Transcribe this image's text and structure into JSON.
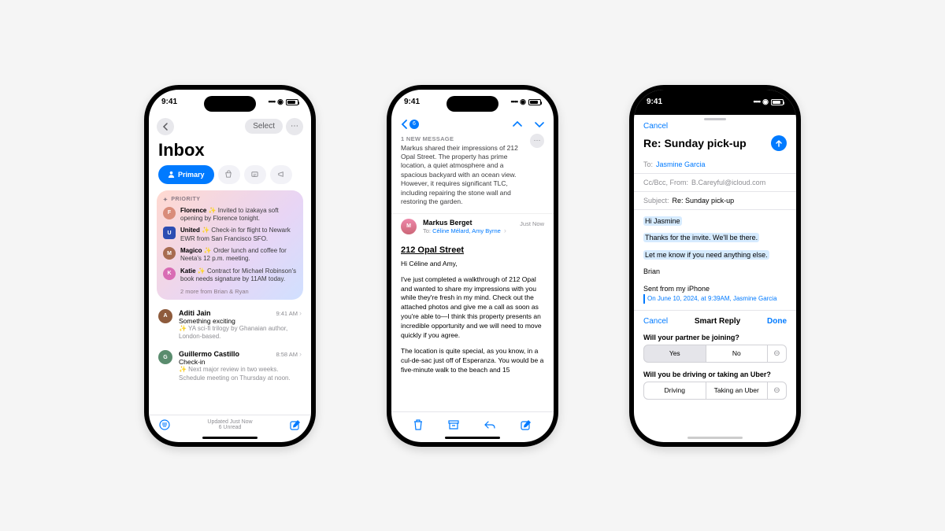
{
  "status": {
    "time": "9:41"
  },
  "phone1": {
    "nav": {
      "select": "Select"
    },
    "title": "Inbox",
    "tabs": {
      "primary": "Primary"
    },
    "priority": {
      "label": "PRIORITY",
      "items": [
        {
          "name": "Florence",
          "text": "Invited to izakaya soft opening by Florence tonight.",
          "bg": "#d98c7a"
        },
        {
          "name": "United",
          "text": "Check-in for flight to Newark EWR from San Francisco SFO.",
          "bg": "#2d4db2"
        },
        {
          "name": "Magico",
          "text": "Order lunch and coffee for Neeta's 12 p.m. meeting.",
          "bg": "#a86c50"
        },
        {
          "name": "Katie",
          "text": "Contract for Michael Robinson's book needs signature by 11AM today.",
          "bg": "#d96cb4"
        }
      ],
      "more": "2 more from Brian & Ryan"
    },
    "messages": [
      {
        "sender": "Aditi Jain",
        "time": "9:41 AM",
        "subject": "Something exciting",
        "preview": "✨ YA sci-fi trilogy by Ghanaian author, London-based.",
        "bg": "#8e5b3c"
      },
      {
        "sender": "Guillermo Castillo",
        "time": "8:58 AM",
        "subject": "Check-in",
        "preview": "✨ Next major review in two weeks. Schedule meeting on Thursday at noon.",
        "bg": "#5a8c6e"
      }
    ],
    "footer": {
      "updated": "Updated Just Now",
      "unread": "6 Unread"
    }
  },
  "phone2": {
    "newMsgLabel": "1 NEW MESSAGE",
    "summary": "Markus shared their impressions of 212 Opal Street. The property has prime location, a quiet atmosphere and a spacious backyard with an ocean view. However, it requires significant TLC, including repairing the stone wall and restoring the garden.",
    "from": "Markus Berget",
    "to": "Céline Mélard, Amy Byrne",
    "toLabel": "To:",
    "when": "Just Now",
    "subject": "212 Opal Street",
    "body": {
      "greeting": "Hi Céline and Amy,",
      "p1": "I've just completed a walkthrough of 212 Opal and wanted to share my impressions with you while they're fresh in my mind. Check out the attached photos and give me a call as soon as you're able to—I think this property presents an incredible opportunity and we will need to move quickly if you agree.",
      "p2": "The location is quite special, as you know, in a cul-de-sac just off of Esperanza. You would be a five-minute walk to the beach and 15"
    }
  },
  "phone3": {
    "cancel": "Cancel",
    "title": "Re: Sunday pick-up",
    "fields": {
      "to": "To:",
      "toVal": "Jasmine Garcia",
      "cc": "Cc/Bcc, From:",
      "ccVal": "B.Careyful@icloud.com",
      "subject": "Subject:",
      "subjectVal": "Re: Sunday pick-up"
    },
    "body": {
      "greeting": "Hi Jasmine",
      "l1": "Thanks for the invite. We'll be there.",
      "l2": "Let me know if you need anything else.",
      "sig": "Brian",
      "sent": "Sent from my iPhone",
      "quote": "On June 10, 2024, at 9:39AM, Jasmine Garcia"
    },
    "smart": {
      "cancel": "Cancel",
      "title": "Smart Reply",
      "done": "Done"
    },
    "q1": {
      "text": "Will your partner be joining?",
      "a": "Yes",
      "b": "No"
    },
    "q2": {
      "text": "Will you be driving or taking an Uber?",
      "a": "Driving",
      "b": "Taking an Uber"
    }
  }
}
